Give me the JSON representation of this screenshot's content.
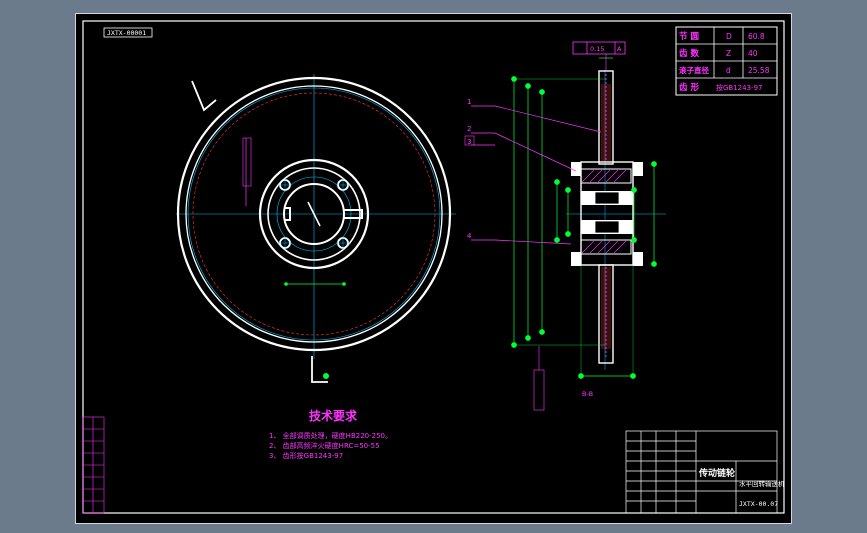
{
  "drawing": {
    "drawing_number": "JXTX-00001",
    "gear_params": [
      {
        "label": "节 圆",
        "symbol": "D",
        "value": "60.8"
      },
      {
        "label": "齿 数",
        "symbol": "Z",
        "value": "40"
      },
      {
        "label": "滚子直径",
        "symbol": "d",
        "value": "25.58"
      },
      {
        "label": "齿 形",
        "symbol": "",
        "value": "按GB1243-97"
      }
    ],
    "tolerance_frame": {
      "value": "0.15",
      "datum": "A"
    },
    "leaders": [
      "1",
      "2",
      "3",
      "4"
    ],
    "section_label": "B-B",
    "tech_title": "技术要求",
    "tech_notes": [
      "1、 全部调质处理，硬度HB220-250。",
      "2、 齿部高频淬火硬度HRC=50-55",
      "3、 齿形按GB1243-97"
    ],
    "title_block": {
      "part_name": "传动链轮",
      "org": "水平回转输送机",
      "code": "JXTX-00.07"
    }
  },
  "colors": {
    "line": "#ffffff",
    "center": "#00bfff",
    "dim": "#00ff33",
    "note": "#ff33ff",
    "hidden": "#ff3333",
    "leader": "#ff33ff"
  }
}
